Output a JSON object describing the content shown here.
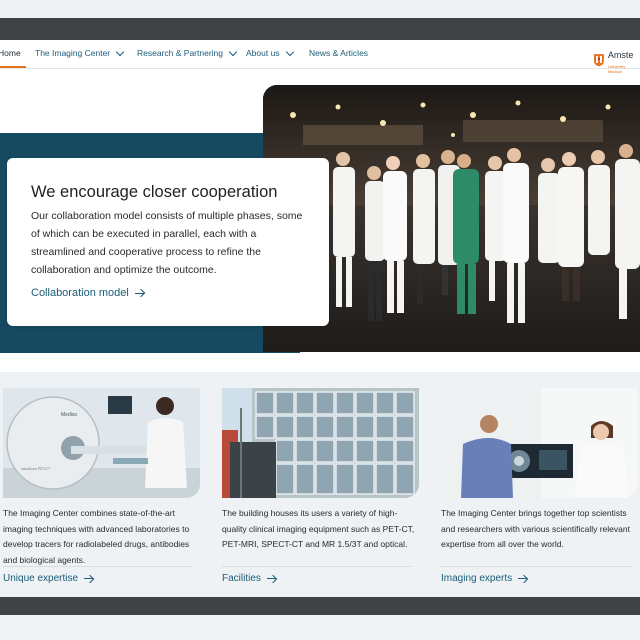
{
  "nav": {
    "home": "Home",
    "items": [
      {
        "label": "The Imaging Center",
        "has_dropdown": true
      },
      {
        "label": "Research & Partnering",
        "has_dropdown": true
      },
      {
        "label": "About us",
        "has_dropdown": true
      },
      {
        "label": "News & Articles",
        "has_dropdown": false
      }
    ],
    "logo_text": "Amste",
    "logo_sub": "University Medical"
  },
  "hero": {
    "title": "We encourage closer cooperation",
    "text": "Our collaboration model consists of multiple phases, some of which can be executed in parallel, each with a streamlined and cooperative process to refine the collaboration and optimize the outcome.",
    "link": "Collaboration model"
  },
  "cards": [
    {
      "text": "The Imaging Center combines state-of-the-art imaging techniques with advanced laboratories to develop tracers for radiolabeled drugs, antibodies and biological agents.",
      "link": "Unique expertise",
      "machine_brand": "Mediso",
      "machine_model": "nanoScan PET/CT"
    },
    {
      "text": "The building houses its users a variety of high-quality clinical imaging equipment such as PET-CT, PET-MRI, SPECT-CT and MR 1.5/3T and optical.",
      "link": "Facilities"
    },
    {
      "text": "The Imaging Center brings together top scientists and researchers with various scientifically relevant expertise from all over the world.",
      "link": "Imaging experts"
    }
  ],
  "colors": {
    "accent": "#1a5c7a",
    "hero_band": "#164a60",
    "brand_orange": "#e8701e",
    "cards_bg": "#eef2f4"
  }
}
